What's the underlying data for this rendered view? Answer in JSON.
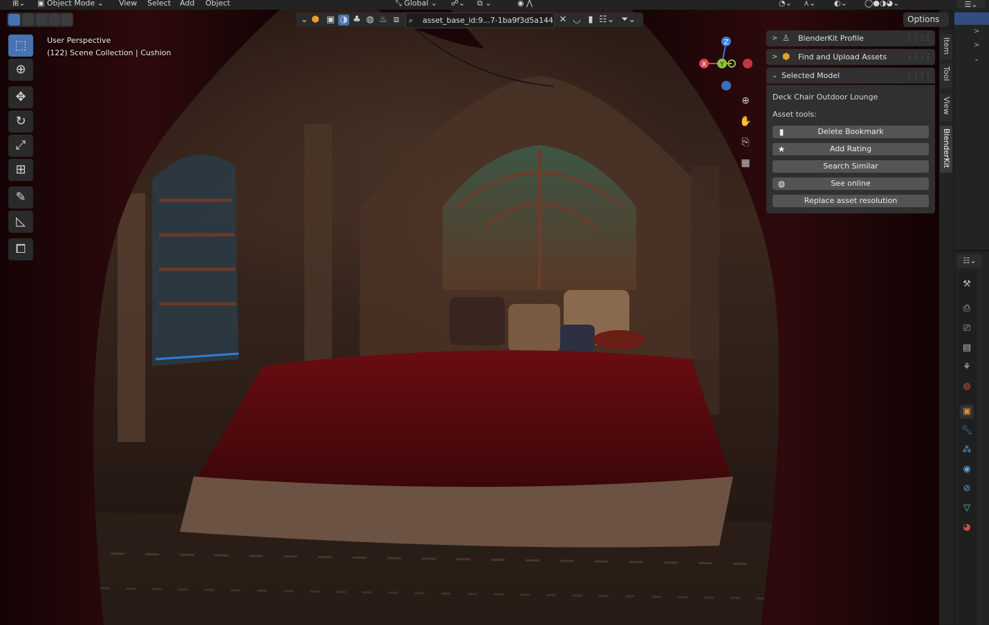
{
  "header": {
    "mode_label": "Object Mode",
    "menus": [
      "View",
      "Select",
      "Add",
      "Object"
    ],
    "transform_orientation": "Global",
    "search_value": "asset_base_id:9...7-1ba9f3d5a144",
    "options_label": "Options"
  },
  "viewport": {
    "perspective_label": "User Perspective",
    "collection_label": "(122) Scene Collection | Cushion",
    "gizmo": {
      "z": "Z",
      "y": "Y",
      "x": "X",
      "x_color": "#e04050",
      "y_color": "#8cc63f",
      "z_color": "#3f7fd8"
    }
  },
  "npanel": {
    "profile_title": "BlenderKit Profile",
    "find_title": "Find and Upload Assets",
    "selected_title": "Selected Model",
    "model_name": "Deck Chair Outdoor Lounge",
    "asset_tools_label": "Asset tools:",
    "buttons": {
      "delete_bookmark": "Delete Bookmark",
      "add_rating": "Add Rating",
      "search_similar": "Search Similar",
      "see_online": "See online",
      "replace_resolution": "Replace asset resolution"
    }
  },
  "tabs": [
    "Item",
    "Tool",
    "View",
    "BlenderKit"
  ],
  "colors": {
    "accent": "#4772b3",
    "panel": "#303030",
    "button": "#545454"
  }
}
